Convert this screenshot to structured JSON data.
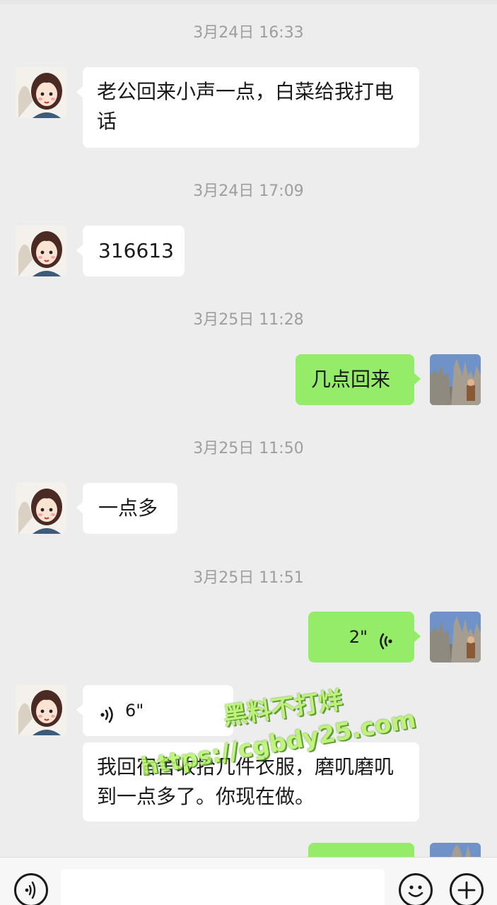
{
  "timestamps": [
    "3月24日 16:33",
    "3月24日 17:09",
    "3月25日 11:28",
    "3月25日 11:50",
    "3月25日 11:51"
  ],
  "messages": [
    {
      "sender": "other",
      "type": "text",
      "text": "老公回来小声一点，白菜给我打电话"
    },
    {
      "sender": "other",
      "type": "text",
      "text": "316613"
    },
    {
      "sender": "me",
      "type": "text",
      "text": "几点回来"
    },
    {
      "sender": "other",
      "type": "text",
      "text": "一点多"
    },
    {
      "sender": "me",
      "type": "voice",
      "duration": "2\""
    },
    {
      "sender": "other",
      "type": "voice",
      "duration": "6\""
    },
    {
      "sender": "other",
      "type": "text",
      "text": "我回宿舍收拾几件衣服，磨叽磨叽到一点多了。你现在做。"
    }
  ],
  "watermark": {
    "line1": "黑料不打烊",
    "line2": "https://cgbdy25.com"
  },
  "input_bar": {
    "left_icon": "voice-input-icon",
    "right_icons": [
      "emoji-icon",
      "plus-icon"
    ],
    "input_value": ""
  },
  "colors": {
    "background": "#ededed",
    "other_bubble": "#ffffff",
    "my_bubble": "#95ec69",
    "timestamp": "#9e9e9e"
  }
}
